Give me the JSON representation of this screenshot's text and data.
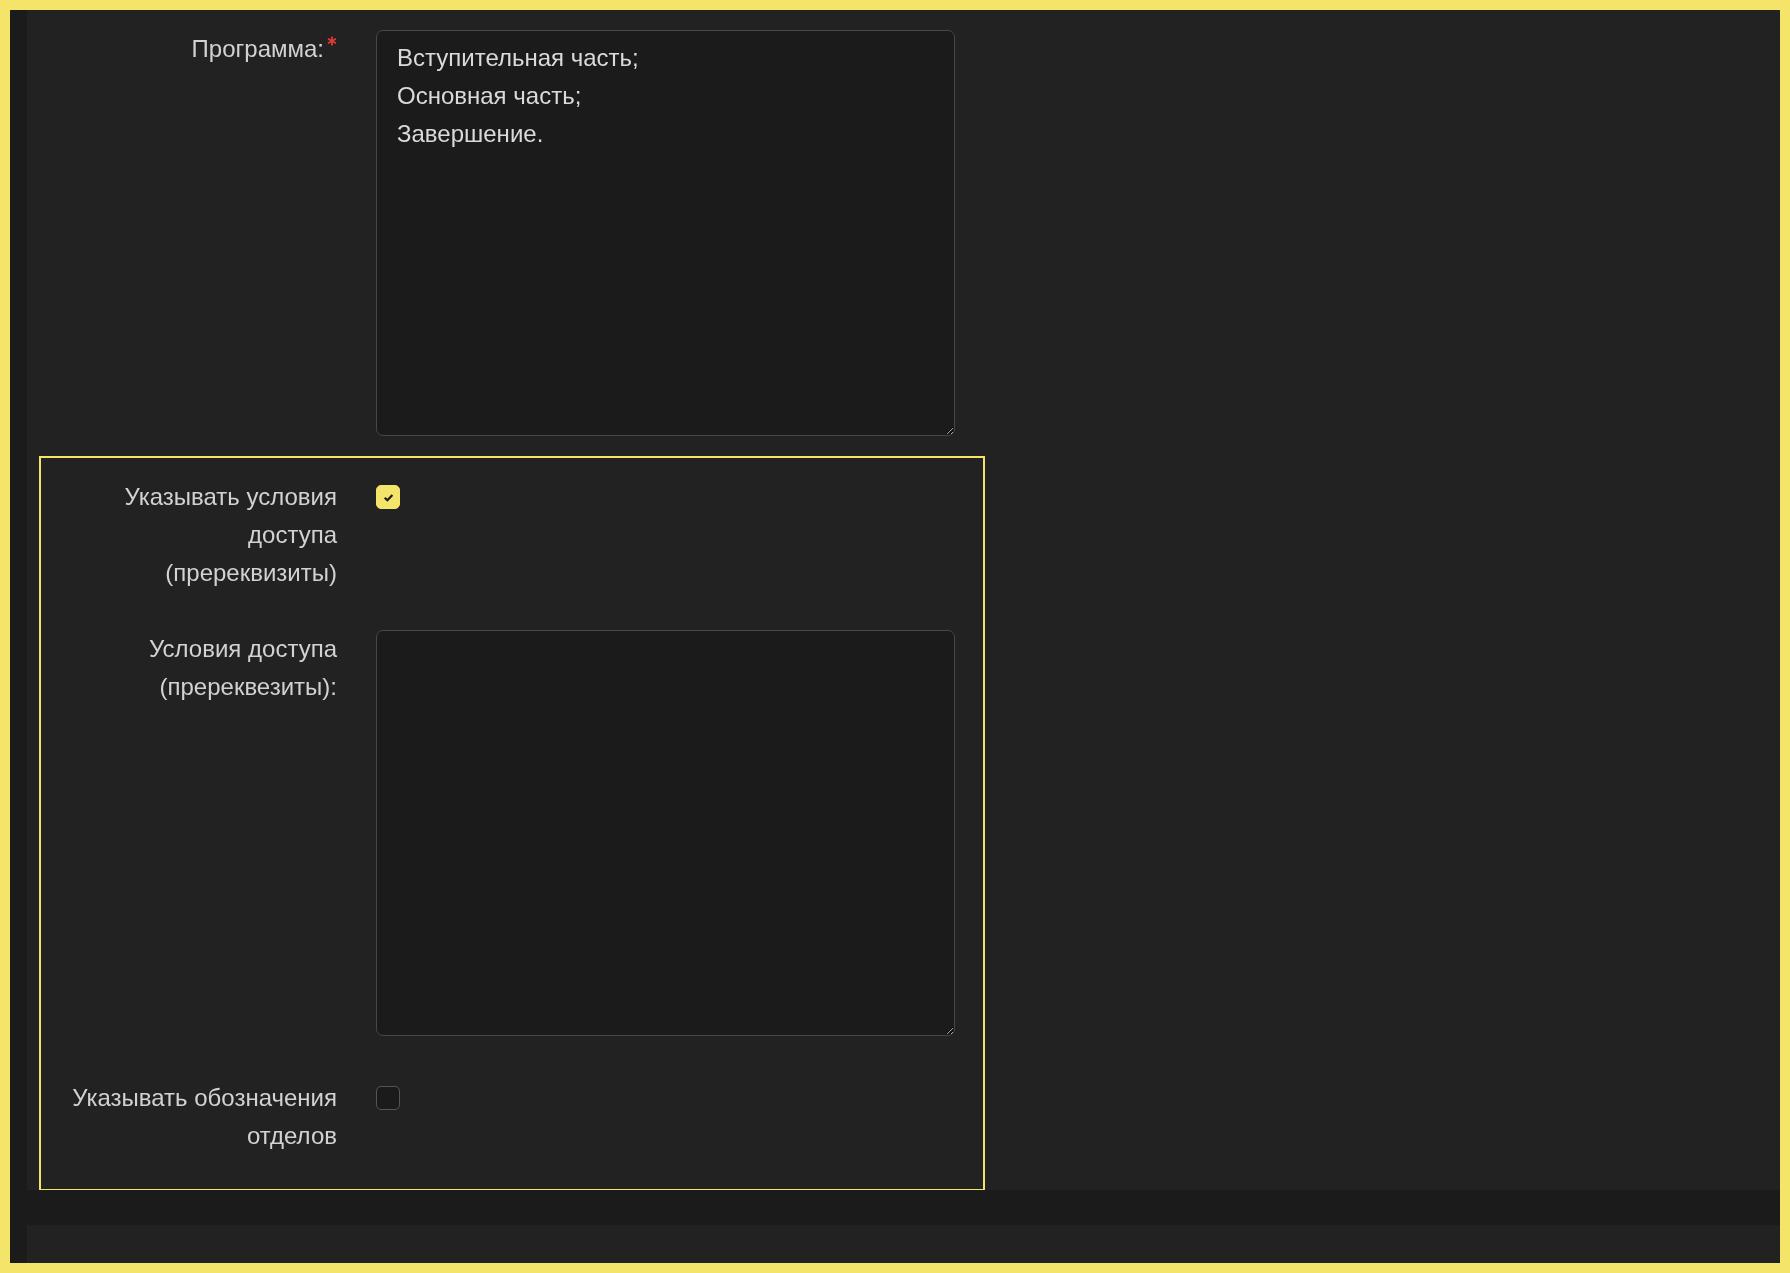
{
  "fields": [
    {
      "kind": "textarea",
      "label": "Программа:",
      "required": true,
      "value": "Вступительная часть;\nОсновная часть;\nЗавершение."
    }
  ],
  "highlighted_section": {
    "highlighted": true,
    "fields": [
      {
        "kind": "checkbox",
        "label": "Указывать условия доступа (пререквизиты)",
        "required": false,
        "checked": true
      },
      {
        "kind": "textarea",
        "label": "Условия доступа (пререквезиты):",
        "required": false
      },
      {
        "kind": "checkbox",
        "label": "Указывать обозначения отделов",
        "required": false,
        "checked": false
      }
    ]
  }
}
